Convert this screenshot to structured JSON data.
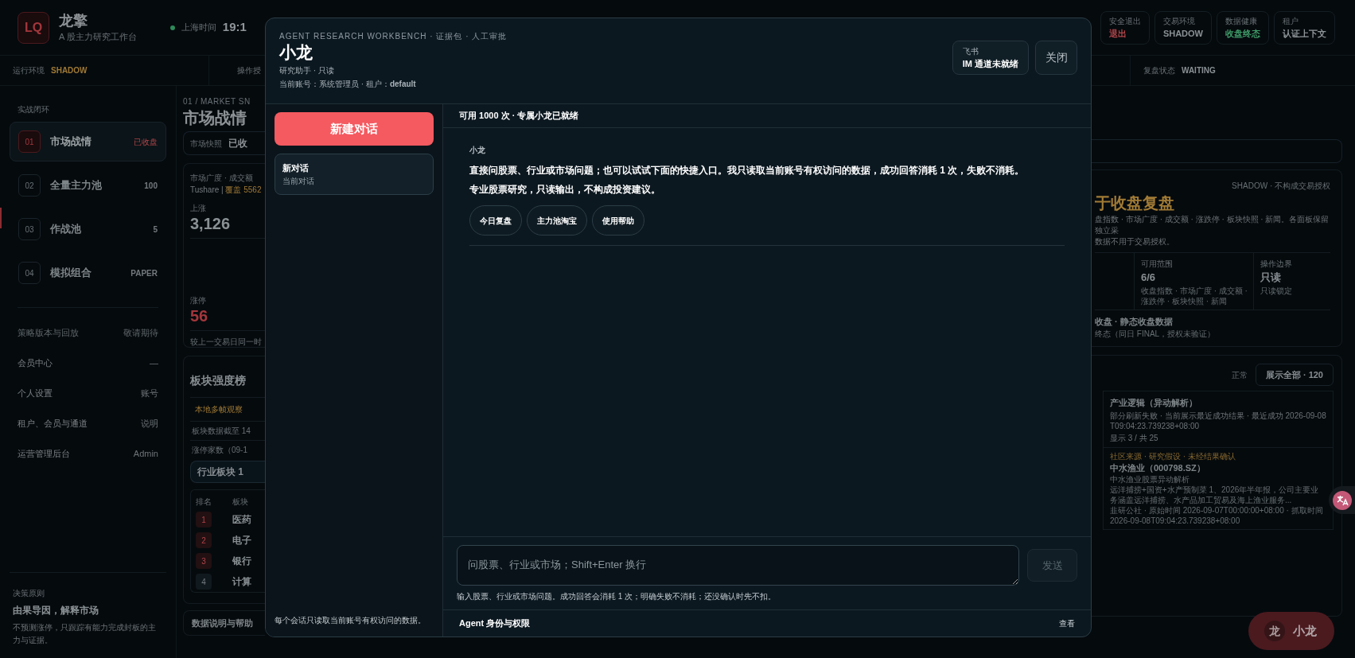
{
  "topbar": {
    "logo": "LQ",
    "app_name": "龙擎",
    "subtitle": "A 股主力研究工作台",
    "clock_label": "上海时间",
    "clock": "19:1",
    "status_cards": [
      {
        "label": "安全退出",
        "value": "退出",
        "kind": "danger"
      },
      {
        "label": "交易环境",
        "value": "SHADOW",
        "kind": "neutral"
      },
      {
        "label": "数据健康",
        "value": "收盘终态",
        "kind": "ok"
      },
      {
        "label": "租户",
        "value": "认证上下文",
        "kind": "plain"
      }
    ]
  },
  "env_bar": {
    "left_label": "运行环境",
    "left_value": "SHADOW",
    "middle_label": "操作授",
    "right_label": "复盘状态",
    "right_value": "WAITING"
  },
  "sidebar": {
    "section": "实战闭环",
    "nav": [
      {
        "index": "01",
        "label": "市场战情",
        "badge": "已收盘",
        "selected": true
      },
      {
        "index": "02",
        "label": "全量主力池",
        "badge": "100",
        "selected": false
      },
      {
        "index": "03",
        "label": "作战池",
        "badge": "5",
        "selected": false
      },
      {
        "index": "04",
        "label": "模拟组合",
        "badge": "PAPER",
        "selected": false
      }
    ],
    "links": [
      {
        "label": "策略版本与回放",
        "hint": "敬请期待",
        "disabled": true
      },
      {
        "label": "会员中心",
        "hint": "—",
        "disabled": false
      },
      {
        "label": "个人设置",
        "hint": "账号",
        "disabled": false
      },
      {
        "label": "租户、会员与通道",
        "hint": "说明",
        "disabled": false
      },
      {
        "label": "运营管理后台",
        "hint": "Admin",
        "disabled": false
      }
    ],
    "principle": {
      "label": "决策原则",
      "title": "由果导因，解释市场",
      "text": "不预测涨停，只跟踪有能力完成封板的主力与证据。"
    }
  },
  "market": {
    "eyebrow": "01 / MARKET SN",
    "title": "市场战情",
    "snapshot_label": "市场快照",
    "snapshot_value": "已收",
    "breadth": {
      "title": "市场广度 · 成交额",
      "source": "Tushare | ",
      "coverage": "覆盖 5562",
      "up_label": "上涨",
      "up_value": "3,126",
      "limit_label": "涨停",
      "limit_value": "56",
      "note": "较上一交易日同一时"
    },
    "sectors": {
      "title": "板块强度榜",
      "tab": "本地多帧观察",
      "lines": [
        "板块数据截至 14",
        "涨停家数（09-1"
      ],
      "filter": "行业板块 1",
      "columns": [
        "排名",
        "板块"
      ],
      "rows": [
        {
          "rank": "1",
          "name": "医药",
          "top": true
        },
        {
          "rank": "2",
          "name": "电子",
          "top": true
        },
        {
          "rank": "3",
          "name": "银行",
          "top": true
        },
        {
          "rank": "4",
          "name": "计算",
          "top": false
        }
      ]
    },
    "help": "数据说明与帮助"
  },
  "review": {
    "tag": "SHADOW · 不构成交易授权",
    "title": "于收盘复盘",
    "desc_lines": [
      "盘指数 · 市场广度 · 成交额 · 涨跌停 · 板块快照 · 新闻。各面板保留独立采",
      "数据不用于交易授权。"
    ],
    "stats": [
      {
        "label": "可用范围",
        "value": "6/6",
        "note": "收盘指数 · 市场广度 · 成交额 · 涨跌停 · 板块快照 · 新闻"
      },
      {
        "label": "操作边界",
        "value": "只读",
        "note": "只读锁定"
      }
    ],
    "status_title": "收盘 · 静态收盘数据",
    "status_note": "终态（同日 FINAL，授权未验证）"
  },
  "news": {
    "status": "正常",
    "show_all": "展示全部 · 120",
    "topic": "产业逻辑（异动解析）",
    "refresh_note": "部分刷新失败 · 当前展示最近成功结果 · 最近成功 2026-09-08T09:04:23.739238+08:00",
    "count": "显示 3 / 共 25",
    "item": {
      "tag": "社区来源 · 研究假设 · 未经结果确认",
      "title": "中水渔业（000798.SZ）",
      "subtitle": "中水渔业股票异动解析",
      "summary": "远洋捕捞+国资+水产预制菜 1、2026年半年报，公司主要业务涵盖远洋捕捞、水产品加工贸易及海上渔业服务...",
      "meta": "韭研公社 · 原始时间 2026-09-07T00:00:00+08:00 · 抓取时间 2026-09-08T09:04:23.739238+08:00"
    }
  },
  "floating_button": {
    "avatar": "龙",
    "label": "小龙"
  },
  "modal": {
    "eyebrow": "AGENT RESEARCH WORKBENCH · 证据包 · 人工审批",
    "title": "小龙",
    "role": "研究助手 · 只读",
    "account": "当前账号：系统管理员 · 租户：**default**",
    "channel": {
      "label": "飞书",
      "value": "IM 通道未就绪"
    },
    "close": "关闭",
    "new_chat": "新建对话",
    "sessions": [
      {
        "title": "新对话",
        "subtitle": "当前对话",
        "selected": true
      }
    ],
    "session_note": "每个会话只读取当前账号有权访问的数据。",
    "quota": "可用 1000 次 · 专属小龙已就绪",
    "messages": [
      {
        "sender": "小龙",
        "text": "直接问股票、行业或市场问题；也可以试试下面的快捷入口。我只读取当前账号有权访问的数据，成功回答消耗 1 次，失败不消耗。专业股票研究，只读输出，不构成投资建议。",
        "chips": [
          "今日复盘",
          "主力池淘宝",
          "使用帮助"
        ]
      }
    ],
    "input_placeholder": "问股票、行业或市场；Shift+Enter 换行",
    "send": "发送",
    "send_disabled": true,
    "input_hint": "输入股票、行业或市场问题。成功回答会消耗 1 次；明确失败不消耗；还没确认时先不扣。",
    "footer_title": "Agent 身份与权限",
    "footer_action": "查看"
  }
}
